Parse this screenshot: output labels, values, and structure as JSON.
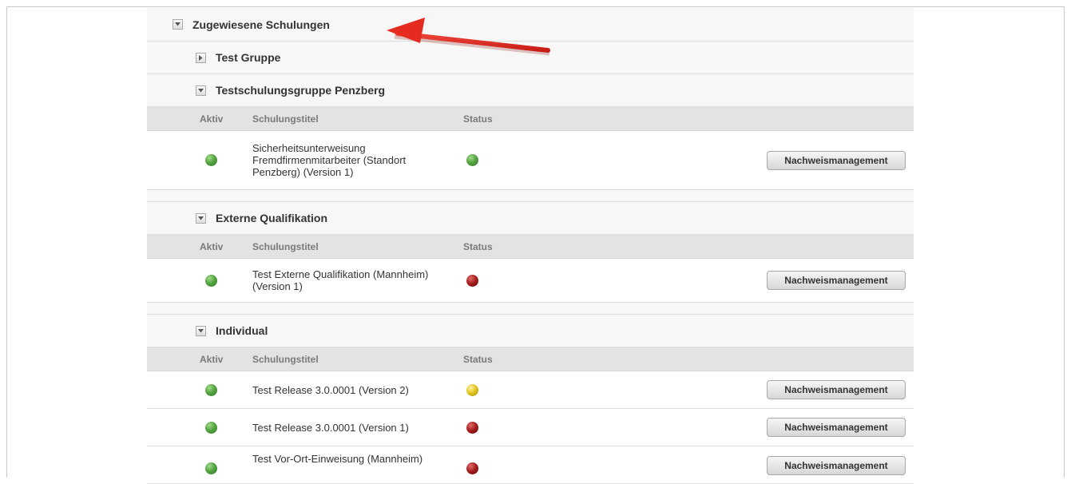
{
  "main": {
    "title": "Zugewiesene Schulungen",
    "columns": {
      "aktiv": "Aktiv",
      "titel": "Schulungstitel",
      "status": "Status"
    },
    "groups": [
      {
        "name": "Test Gruppe",
        "expanded": false
      },
      {
        "name": "Testschulungsgruppe Penzberg",
        "expanded": true,
        "rows": [
          {
            "title": "Sicherheitsunterweisung Fremdfirmenmitarbeiter (Standort Penzberg) (Version 1)",
            "aktiv": "green",
            "status": "green",
            "button": "Nachweismanagement"
          }
        ]
      },
      {
        "name": "Externe Qualifikation",
        "expanded": true,
        "rows": [
          {
            "title": "Test Externe Qualifikation (Mannheim) (Version 1)",
            "aktiv": "green",
            "status": "red",
            "button": "Nachweismanagement"
          }
        ]
      },
      {
        "name": "Individual",
        "expanded": true,
        "rows": [
          {
            "title": "Test Release 3.0.0001 (Version 2)",
            "aktiv": "green",
            "status": "yellow",
            "button": "Nachweismanagement"
          },
          {
            "title": "Test Release 3.0.0001 (Version 1)",
            "aktiv": "green",
            "status": "red",
            "button": "Nachweismanagement"
          },
          {
            "title": "Test Vor-Ort-Einweisung (Mannheim)",
            "aktiv": "green",
            "status": "red",
            "button": "Nachweismanagement"
          }
        ]
      }
    ]
  },
  "colors": {
    "green": "#4e9e3e",
    "red": "#9a1a1a",
    "yellow": "#d8bb1a",
    "annotation_arrow": "#e52b20"
  }
}
